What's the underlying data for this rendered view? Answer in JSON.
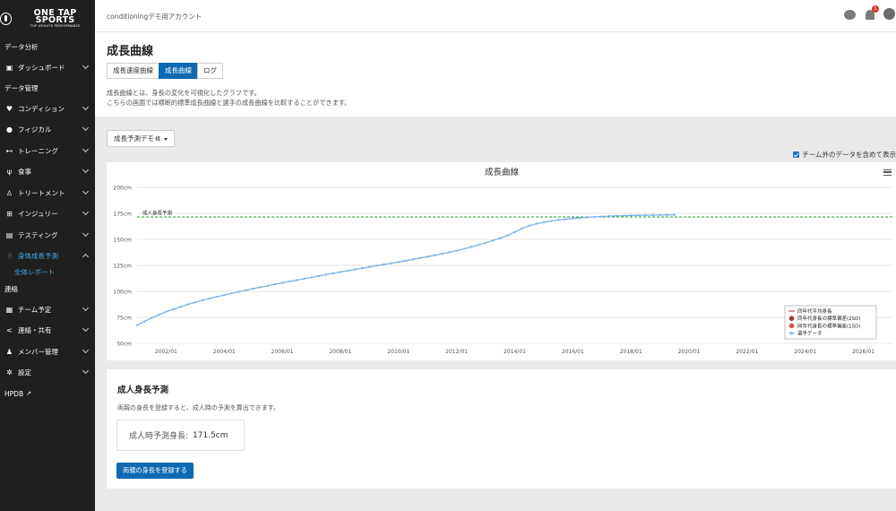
{
  "logo": {
    "name": "ONE TAP SPORTS",
    "tagline": "TOP ATHLETE PERFORMANCE"
  },
  "header": {
    "account": "conditioningデモ用アカウント",
    "notification_count": "1"
  },
  "sidebar": {
    "sections": [
      "データ分析",
      "データ管理",
      "連絡"
    ],
    "items": [
      {
        "label": "ダッシュボード"
      },
      {
        "label": "コンディション"
      },
      {
        "label": "フィジカル"
      },
      {
        "label": "トレーニング"
      },
      {
        "label": "食事"
      },
      {
        "label": "トリートメント"
      },
      {
        "label": "インジュリー"
      },
      {
        "label": "テスティング"
      },
      {
        "label": "身体成長予測"
      },
      {
        "label": "チーム予定"
      },
      {
        "label": "連絡・共有"
      },
      {
        "label": "メンバー管理"
      },
      {
        "label": "設定"
      },
      {
        "label": "HPDB"
      }
    ],
    "sub_item": "全体レポート"
  },
  "page": {
    "title": "成長曲線",
    "tabs": [
      "成長速度曲線",
      "成長曲線",
      "ログ"
    ],
    "desc_line1": "成長曲線とは、身長の変化を可視化したグラフです。",
    "desc_line2": "こちらの画面では横断的標準成長曲線と選手の成長曲線を比較することができます。",
    "dropdown": "成長予測デモ",
    "dropdown_suffix": "様",
    "checkbox_label": "チーム外のデータを含めて表示"
  },
  "chart_data": {
    "type": "line",
    "title": "成長曲線",
    "y_ticks": [
      "200cm",
      "175cm",
      "150cm",
      "125cm",
      "100cm",
      "75cm",
      "50cm"
    ],
    "x_ticks": [
      "2002/01",
      "2004/01",
      "2006/01",
      "2008/01",
      "2010/01",
      "2012/01",
      "2014/01",
      "2016/01",
      "2018/01",
      "2020/01",
      "2022/01",
      "2024/01",
      "2026/01"
    ],
    "ylim": [
      50,
      200
    ],
    "xlim": [
      2001,
      2027
    ],
    "grid": true,
    "colors": {
      "line": "#7db2e5",
      "prediction": "#2e9a2e"
    },
    "annotation": {
      "label": "成人身長予測",
      "value": 171.5
    },
    "legend": {
      "placement": "bottom-right",
      "entries": [
        "同年代平均身長",
        "同年代身長の標準偏差(2SD)",
        "同年代身長の標準偏差(1SD)",
        "選手データ"
      ],
      "colors": [
        "#b03030",
        "#a83232",
        "#d9534f",
        "#7db2e5"
      ]
    },
    "series": [
      {
        "name": "選手データ",
        "x": [
          2001.0,
          2001.25,
          2001.5,
          2001.75,
          2002.0,
          2002.25,
          2002.5,
          2002.75,
          2003.0,
          2003.25,
          2003.5,
          2003.75,
          2004.0,
          2004.25,
          2004.5,
          2004.75,
          2005.0,
          2005.25,
          2005.5,
          2005.75,
          2006.0,
          2006.25,
          2006.5,
          2006.75,
          2007.0,
          2007.25,
          2007.5,
          2007.75,
          2008.0,
          2008.25,
          2008.5,
          2008.75,
          2009.0,
          2009.25,
          2009.5,
          2009.75,
          2010.0,
          2010.25,
          2010.5,
          2010.75,
          2011.0,
          2011.25,
          2011.5,
          2011.75,
          2012.0,
          2012.25,
          2012.5,
          2012.75,
          2013.0,
          2013.25,
          2013.5,
          2013.75,
          2014.0,
          2014.25,
          2014.5,
          2014.75,
          2015.0,
          2015.25,
          2015.5,
          2015.75,
          2016.0,
          2016.25,
          2016.5,
          2016.75,
          2017.0,
          2017.25,
          2017.5,
          2017.75,
          2018.0,
          2018.25,
          2018.5,
          2018.75,
          2019.0,
          2019.25,
          2019.5
        ],
        "y": [
          67.5,
          71,
          74.5,
          77.5,
          80.5,
          82.8,
          85.2,
          87.5,
          89.5,
          91.5,
          93.2,
          94.8,
          96.4,
          98,
          99.6,
          101.1,
          102.6,
          104,
          105.4,
          106.8,
          108.2,
          109.5,
          110.8,
          112.1,
          113.4,
          114.7,
          116,
          117.3,
          118.6,
          119.9,
          121.1,
          122.3,
          123.5,
          124.7,
          125.9,
          127.1,
          128.3,
          129.5,
          130.8,
          132.1,
          133.4,
          134.7,
          136.1,
          137.6,
          139.2,
          140.9,
          142.7,
          144.6,
          146.7,
          148.9,
          151.2,
          153.8,
          157,
          160.5,
          163.2,
          165,
          166.4,
          167.6,
          168.6,
          169.4,
          170.1,
          170.7,
          171.2,
          171.6,
          172,
          172.3,
          172.6,
          172.8,
          173,
          173.1,
          173.2,
          173.3,
          173.4,
          173.5,
          173.6
        ]
      }
    ]
  },
  "prediction": {
    "title": "成人身長予測",
    "note": "両親の身長を登録すると、成人時の予測を算出できます。",
    "label": "成人時予測身長:",
    "value": "171.5cm",
    "button": "両親の身長を登録する"
  }
}
